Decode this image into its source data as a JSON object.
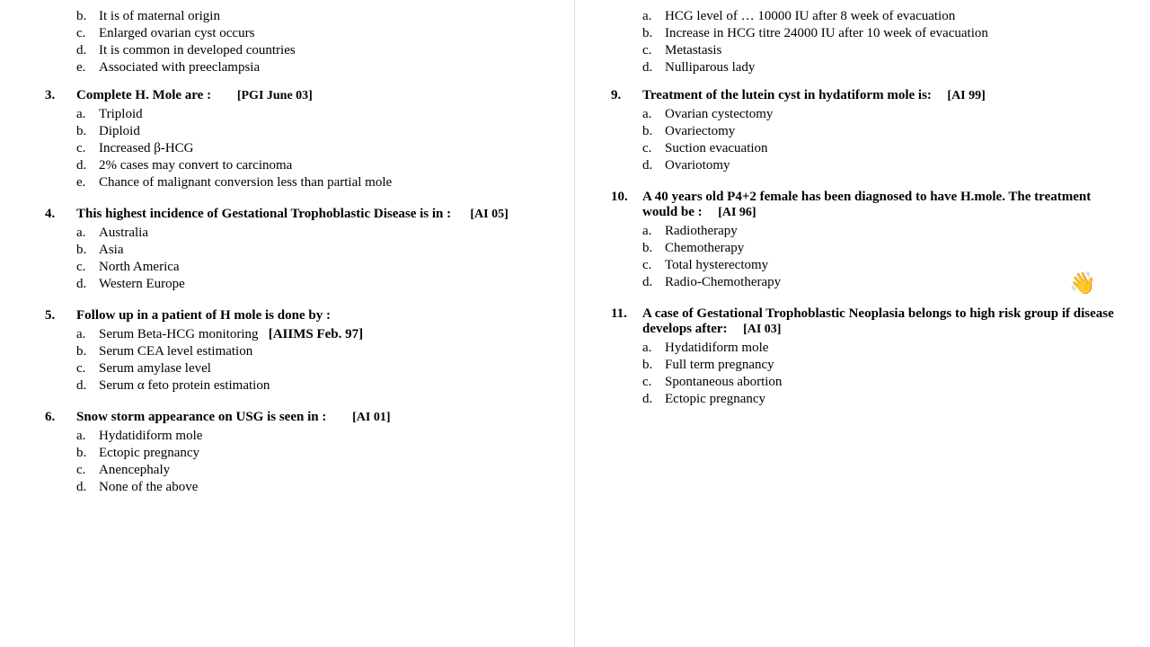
{
  "left_column": {
    "partial_q2": {
      "options": [
        {
          "letter": "b.",
          "text": "It is of maternal origin"
        },
        {
          "letter": "c.",
          "text": "Enlarged ovarian cyst occurs"
        },
        {
          "letter": "d.",
          "text": "It is common in developed countries"
        },
        {
          "letter": "e.",
          "text": "Associated with preeclampsia"
        }
      ]
    },
    "q3": {
      "number": "3.",
      "text": "Complete H. Mole are :",
      "source": "[PGI June 03]",
      "options": [
        {
          "letter": "a.",
          "text": "Triploid"
        },
        {
          "letter": "b.",
          "text": "Diploid"
        },
        {
          "letter": "c.",
          "text": "Increased β-HCG"
        },
        {
          "letter": "d.",
          "text": "2% cases may convert to carcinoma"
        },
        {
          "letter": "e.",
          "text": "Chance of malignant conversion less than partial mole"
        }
      ]
    },
    "q4": {
      "number": "4.",
      "text": "This highest incidence of Gestational Trophoblastic Disease is in :",
      "source": "[AI 05]",
      "options": [
        {
          "letter": "a.",
          "text": "Australia"
        },
        {
          "letter": "b.",
          "text": "Asia"
        },
        {
          "letter": "c.",
          "text": "North America"
        },
        {
          "letter": "d.",
          "text": "Western Europe"
        }
      ]
    },
    "q5": {
      "number": "5.",
      "text": "Follow up in a patient of H mole is done by :",
      "source": "",
      "options": [
        {
          "letter": "a.",
          "text": "Serum Beta-HCG monitoring",
          "source": "[AIIMS Feb. 97]"
        },
        {
          "letter": "b.",
          "text": "Serum CEA level estimation"
        },
        {
          "letter": "c.",
          "text": "Serum amylase level"
        },
        {
          "letter": "d.",
          "text": "Serum α feto protein estimation"
        }
      ]
    },
    "q6": {
      "number": "6.",
      "text": "Snow storm appearance on USG is seen in :",
      "source": "[AI 01]",
      "options": [
        {
          "letter": "a.",
          "text": "Hydatidiform mole"
        },
        {
          "letter": "b.",
          "text": "Ectopic pregnancy"
        },
        {
          "letter": "c.",
          "text": "Anencephaly"
        },
        {
          "letter": "d.",
          "text": "None of the above"
        }
      ]
    }
  },
  "right_column": {
    "partial_q8": {
      "options": [
        {
          "letter": "a.",
          "text": "HCG level of ... 10000 IU after 8 week of evacuation"
        },
        {
          "letter": "b.",
          "text": "Increase in HCG titre 24000 IU after 10 week of evacuation"
        },
        {
          "letter": "c.",
          "text": "Metastasis"
        },
        {
          "letter": "d.",
          "text": "Nulliparous lady"
        }
      ]
    },
    "q9": {
      "number": "9.",
      "text": "Treatment of the lutein cyst in hydatiform mole is:",
      "source": "[AI 99]",
      "options": [
        {
          "letter": "a.",
          "text": "Ovarian cystectomy"
        },
        {
          "letter": "b.",
          "text": "Ovariectomy"
        },
        {
          "letter": "c.",
          "text": "Suction evacuation"
        },
        {
          "letter": "d.",
          "text": "Ovariotomy"
        }
      ]
    },
    "q10": {
      "number": "10.",
      "text": "A 40 years old P4+2 female has been diagnosed to have H.mole. The treatment would be :",
      "source": "[AI 96]",
      "options": [
        {
          "letter": "a.",
          "text": "Radiotherapy"
        },
        {
          "letter": "b.",
          "text": "Chemotherapy"
        },
        {
          "letter": "c.",
          "text": "Total hysterectomy"
        },
        {
          "letter": "d.",
          "text": "Radio-Chemotherapy"
        }
      ]
    },
    "q11": {
      "number": "11.",
      "text": "A case of Gestational Trophoblastic Neoplasia belongs to high risk group if disease develops after:",
      "source": "[AI 03]",
      "options": [
        {
          "letter": "a.",
          "text": "Hydatidiform mole"
        },
        {
          "letter": "b.",
          "text": "Full term pregnancy"
        },
        {
          "letter": "c.",
          "text": "Spontaneous abortion"
        },
        {
          "letter": "d.",
          "text": "Ectopic pregnancy"
        }
      ]
    }
  }
}
